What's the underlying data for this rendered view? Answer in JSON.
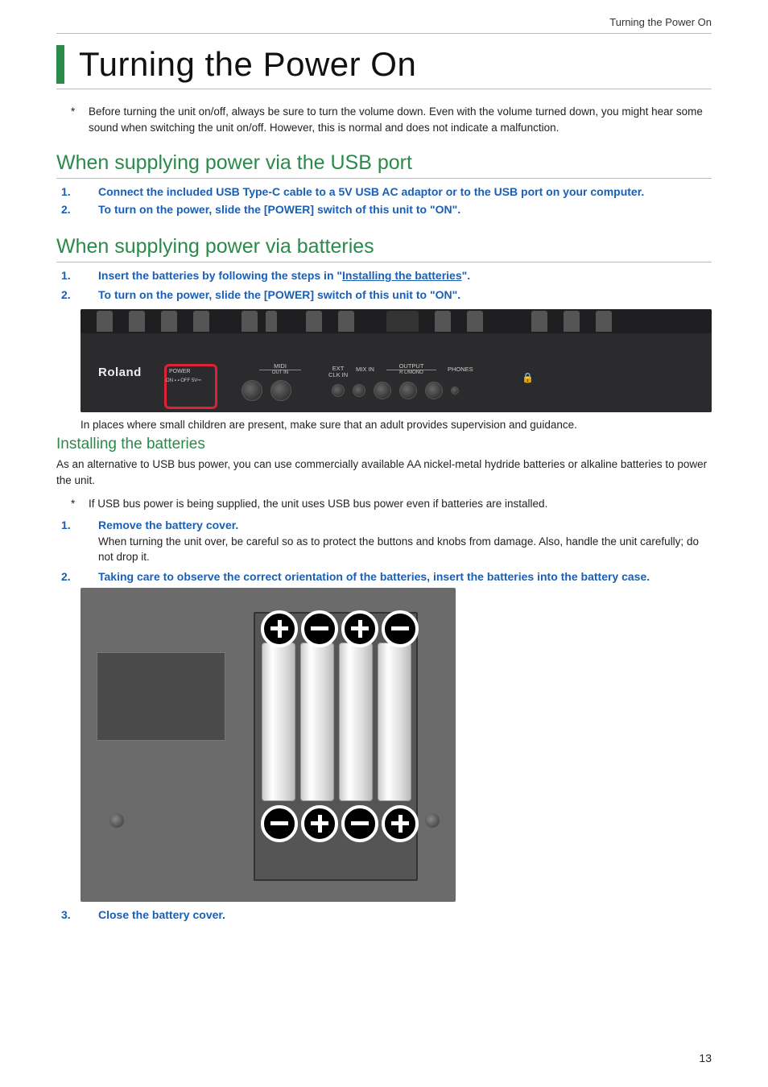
{
  "breadcrumb": "Turning the Power On",
  "title": "Turning the Power On",
  "top_note_marker": "*",
  "top_note": "Before turning the unit on/off, always be sure to turn the volume down. Even with the volume turned down, you might hear some sound when switching the unit on/off. However, this is normal and does not indicate a malfunction.",
  "section_usb": {
    "heading": "When supplying power via the USB port",
    "steps": [
      {
        "n": "1.",
        "text": "Connect the included USB Type-C cable to a 5V USB AC adaptor or to the USB port on your computer."
      },
      {
        "n": "2.",
        "text": "To turn on the power, slide the [POWER] switch of this unit to \"ON\"."
      }
    ]
  },
  "section_batt": {
    "heading": "When supplying power via batteries",
    "steps": [
      {
        "n": "1.",
        "prefix": "Insert the batteries by following the steps in \"",
        "link": "Installing the batteries",
        "suffix": "\"."
      },
      {
        "n": "2.",
        "text": "To turn on the power, slide the [POWER] switch of this unit to \"ON\"."
      }
    ],
    "rear_panel_labels": {
      "brand": "Roland",
      "power": "POWER",
      "onoff": "ON ▪   ▪ OFF   5V⎓",
      "midi": "MIDI",
      "midi_sub": "OUT              IN",
      "ext": "EXT\nCLK IN",
      "mixin": "MIX IN",
      "output": "OUTPUT",
      "output_sub": "R            L/MONO",
      "phones": "PHONES",
      "lock": "🔒"
    },
    "caption_below": "In places where small children are present, make sure that an adult provides supervision and guidance."
  },
  "section_install": {
    "heading": "Installing the batteries",
    "intro": "As an alternative to USB bus power, you can use commercially available AA nickel-metal hydride batteries or alkaline batteries to power the unit.",
    "note_marker": "*",
    "note": "If USB bus power is being supplied, the unit uses USB bus power even if batteries are installed.",
    "steps": [
      {
        "n": "1.",
        "text": "Remove the battery cover.",
        "sub": "When turning the unit over, be careful so as to protect the buttons and knobs from damage. Also, handle the unit carefully; do not drop it."
      },
      {
        "n": "2.",
        "text": "Taking care to observe the correct orientation of the batteries, insert the batteries into the battery case."
      },
      {
        "n": "3.",
        "text": "Close the battery cover."
      }
    ],
    "polarity_top": [
      "plus",
      "minus",
      "plus",
      "minus"
    ],
    "polarity_bot": [
      "minus",
      "plus",
      "minus",
      "plus"
    ]
  },
  "page_number": "13"
}
